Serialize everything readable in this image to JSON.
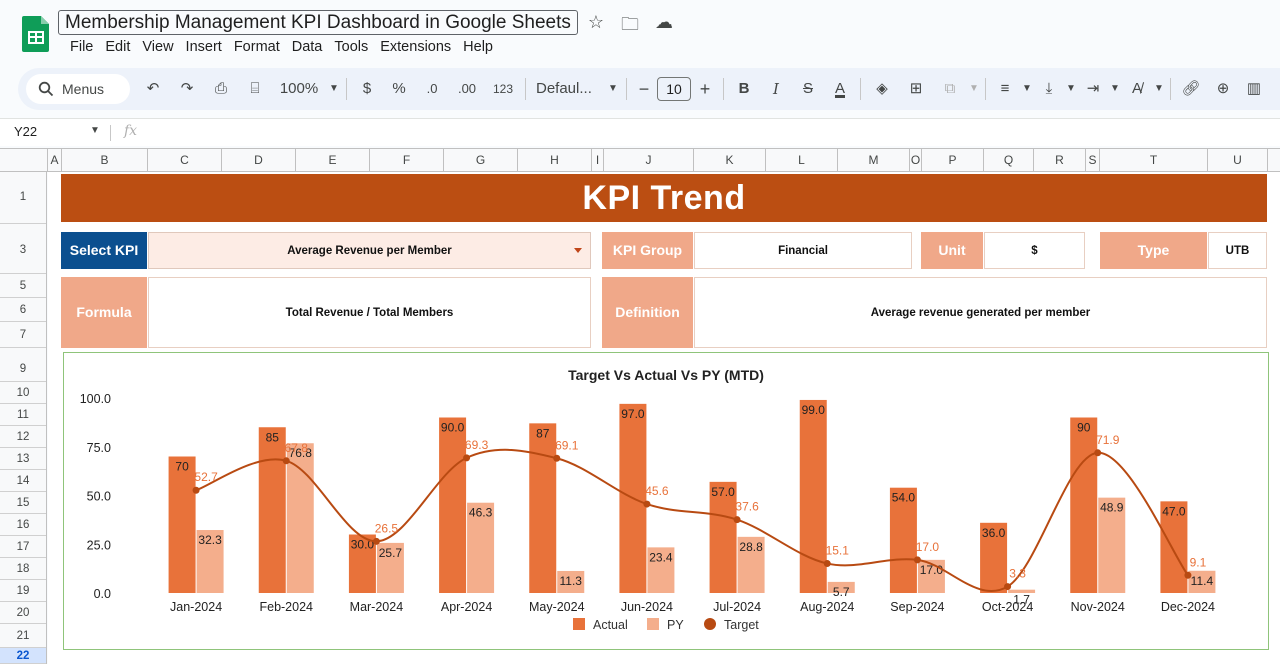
{
  "title_bar": {
    "doc_title": "Membership Management KPI Dashboard in Google Sheets",
    "menu": [
      "File",
      "Edit",
      "View",
      "Insert",
      "Format",
      "Data",
      "Tools",
      "Extensions",
      "Help"
    ]
  },
  "toolbar": {
    "search_label": "Menus",
    "zoom": "100%",
    "currency": "$",
    "percent": "%",
    "dec_decrease": ".0",
    "dec_increase": ".00",
    "number_format": "123",
    "font": "Defaul...",
    "font_size": "10",
    "bold": "B",
    "italic": "I",
    "strike": "S",
    "text_color": "A"
  },
  "formula_bar": {
    "cell_ref": "Y22",
    "fx": "fx",
    "value": ""
  },
  "columns": [
    "A",
    "B",
    "C",
    "D",
    "E",
    "F",
    "G",
    "H",
    "I",
    "J",
    "K",
    "L",
    "M",
    "O",
    "P",
    "Q",
    "R",
    "S",
    "T",
    "U"
  ],
  "rows": [
    "1",
    "3",
    "5",
    "6",
    "7",
    "9",
    "10",
    "11",
    "12",
    "13",
    "14",
    "15",
    "16",
    "17",
    "18",
    "19",
    "20",
    "21",
    "22"
  ],
  "dashboard": {
    "banner": "KPI Trend",
    "select_kpi_label": "Select KPI",
    "select_kpi_value": "Average Revenue per Member",
    "kpi_group_label": "KPI Group",
    "kpi_group_value": "Financial",
    "unit_label": "Unit",
    "unit_value": "$",
    "type_label": "Type",
    "type_value": "UTB",
    "formula_label": "Formula",
    "formula_value": "Total Revenue / Total Members",
    "definition_label": "Definition",
    "definition_value": "Average revenue generated per member"
  },
  "colors": {
    "banner": "#bb4e12",
    "select_label": "#0b4f8f",
    "label_fill": "#f0a889",
    "actual": "#e8723a",
    "py": "#f4ae8c",
    "target": "#b84a12"
  },
  "chart_data": {
    "type": "bar",
    "title": "Target Vs Actual Vs PY (MTD)",
    "categories": [
      "Jan-2024",
      "Feb-2024",
      "Mar-2024",
      "Apr-2024",
      "May-2024",
      "Jun-2024",
      "Jul-2024",
      "Aug-2024",
      "Sep-2024",
      "Oct-2024",
      "Nov-2024",
      "Dec-2024"
    ],
    "series": [
      {
        "name": "Actual",
        "type": "bar",
        "values": [
          70,
          85,
          30.0,
          90,
          87,
          97.0,
          57,
          99.0,
          54.0,
          36.0,
          90,
          47.0
        ],
        "labels": [
          "70",
          "85",
          "30.0",
          "90.0",
          "87",
          "97.0",
          "57.0",
          "99.0",
          "54.0",
          "36.0",
          "90",
          "47.0"
        ]
      },
      {
        "name": "PY",
        "type": "bar",
        "values": [
          32.3,
          76.8,
          25.7,
          46.3,
          11.3,
          23.4,
          28.8,
          5.7,
          17.0,
          1.7,
          48.9,
          11.4
        ],
        "labels": [
          "32.3",
          "76.8",
          "25.7",
          "46.3",
          "11.3",
          "23.4",
          "28.8",
          "5.7",
          "17.0",
          "1.7",
          "48.9",
          "11.4"
        ]
      },
      {
        "name": "Target",
        "type": "line",
        "values": [
          52.7,
          67.8,
          26.5,
          69.3,
          69.1,
          45.6,
          37.6,
          15.1,
          17.0,
          3.3,
          71.9,
          9.1
        ],
        "labels": [
          "52.7",
          "67.8",
          "26.5",
          "69.3",
          "69.1",
          "45.6",
          "37.6",
          "15.1",
          "17.0",
          "3.3",
          "71.9",
          "9.1"
        ]
      }
    ],
    "yticks": [
      "100.0",
      "75.0",
      "50.0",
      "25.0",
      "0.0"
    ],
    "ylim": [
      0,
      100
    ],
    "legend_position": "bottom"
  }
}
